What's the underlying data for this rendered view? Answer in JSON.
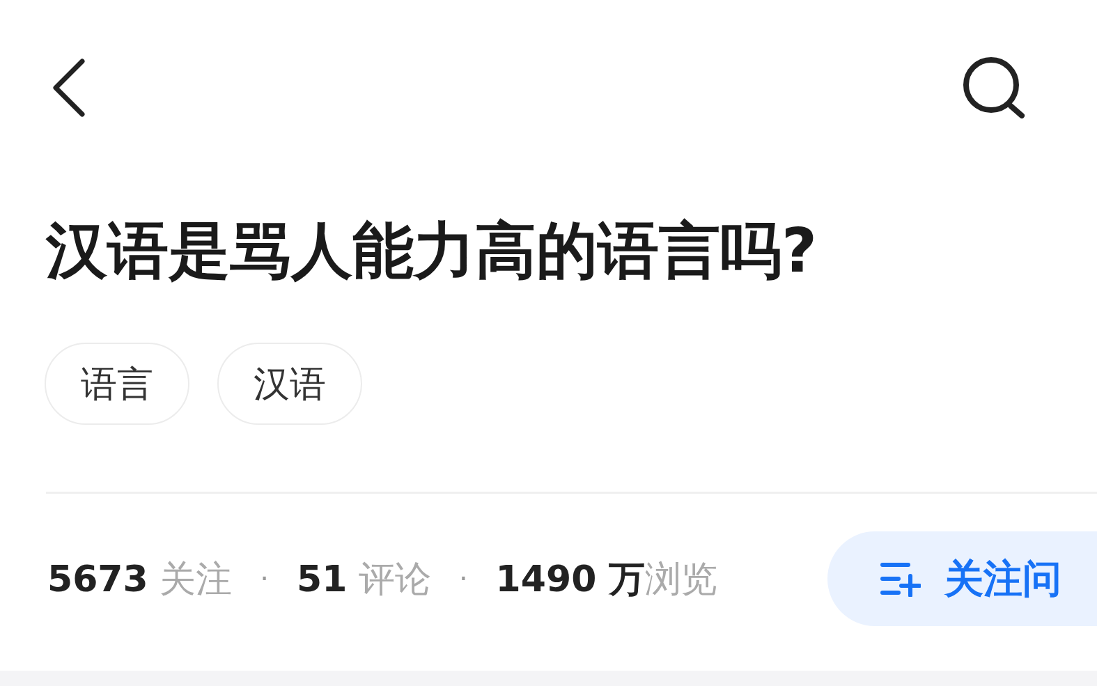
{
  "title": "汉语是骂人能力高的语言吗?",
  "tags": [
    "语言",
    "汉语"
  ],
  "stats": [
    "**5673** 关注",
    "**51** 评论",
    "**1490 万**浏览"
  ],
  "separator": "·",
  "follow_button": {
    "label": "关注问"
  }
}
